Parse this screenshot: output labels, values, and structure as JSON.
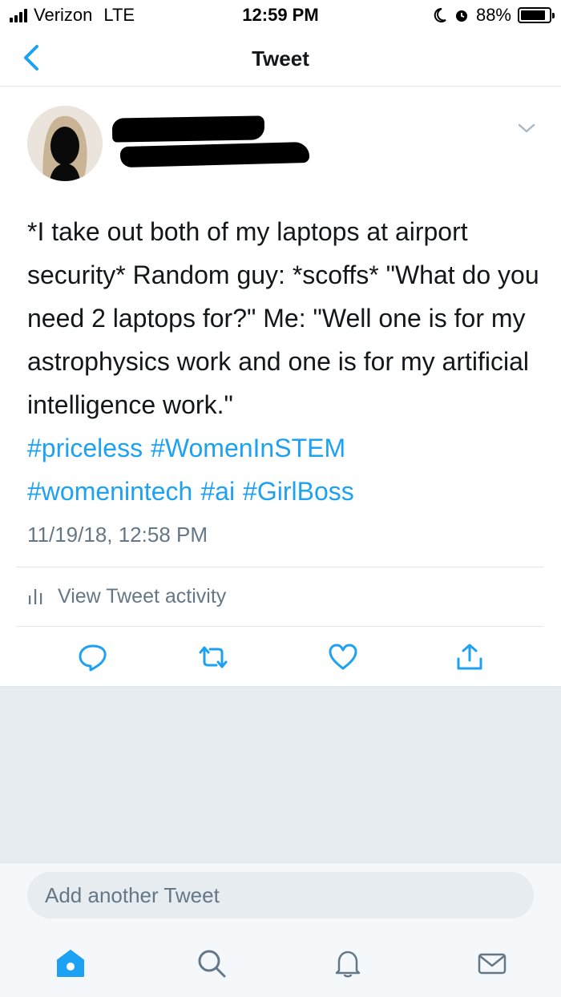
{
  "status_bar": {
    "carrier": "Verizon",
    "network": "LTE",
    "time": "12:59 PM",
    "battery": "88%",
    "battery_level": 0.88
  },
  "nav": {
    "title": "Tweet"
  },
  "tweet": {
    "text": "*I take out both of my laptops at airport security* Random guy: *scoffs* \"What do you need 2 laptops for?\" Me: \"Well one is for my astrophysics work and one is for my artificial intelligence work.\"",
    "hashtags": [
      "#priceless",
      "#WomenInSTEM",
      "#womenintech",
      "#ai",
      "#GirlBoss"
    ],
    "timestamp": "11/19/18, 12:58 PM",
    "activity_label": "View Tweet activity"
  },
  "compose": {
    "placeholder": "Add another Tweet"
  },
  "icons": {
    "back": "chevron-left-icon",
    "more": "chevron-down-icon",
    "reply": "reply-icon",
    "retweet": "retweet-icon",
    "like": "heart-icon",
    "share": "share-icon",
    "activity": "bar-chart-icon",
    "home": "home-icon",
    "search": "search-icon",
    "notifications": "bell-icon",
    "messages": "mail-icon"
  },
  "colors": {
    "accent": "#1da1f2",
    "text": "#14171a",
    "secondary": "#657786",
    "divider": "#e1e8ed",
    "background_gray": "#e6ecf0"
  }
}
